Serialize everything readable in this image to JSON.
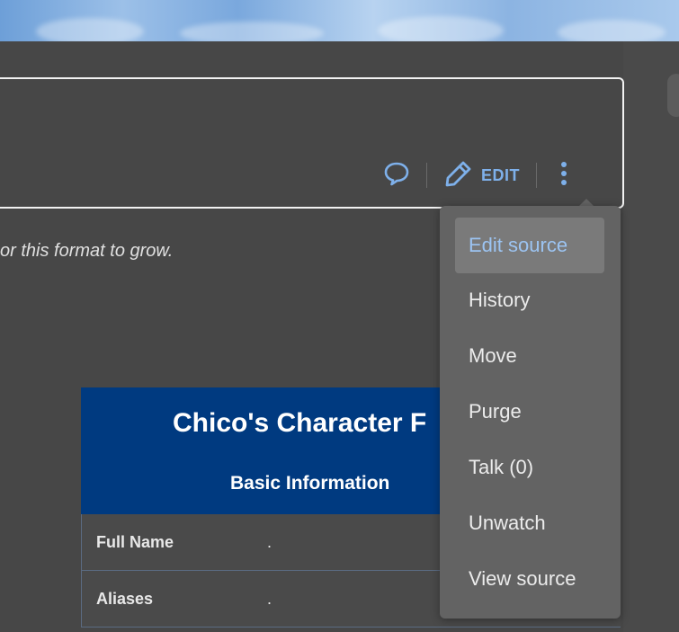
{
  "toolbar": {
    "edit_label": "EDIT"
  },
  "content": {
    "intro_fragment": "or this format to grow."
  },
  "infobox": {
    "title": "Chico's Character F",
    "subtitle": "Basic Information",
    "rows": [
      {
        "label": "Full Name",
        "value": "."
      },
      {
        "label": "Aliases",
        "value": "."
      }
    ],
    "header_color": "#003a80"
  },
  "menu": {
    "items": [
      {
        "label": "Edit source",
        "active": true
      },
      {
        "label": "History"
      },
      {
        "label": "Move"
      },
      {
        "label": "Purge"
      },
      {
        "label": "Talk (0)"
      },
      {
        "label": "Unwatch"
      },
      {
        "label": "View source"
      }
    ]
  },
  "colors": {
    "accent": "#7eb0ea",
    "background": "#474747",
    "menu_background": "#636363"
  },
  "icons": [
    "talk-bubble-icon",
    "pencil-icon",
    "more-vertical-icon"
  ]
}
